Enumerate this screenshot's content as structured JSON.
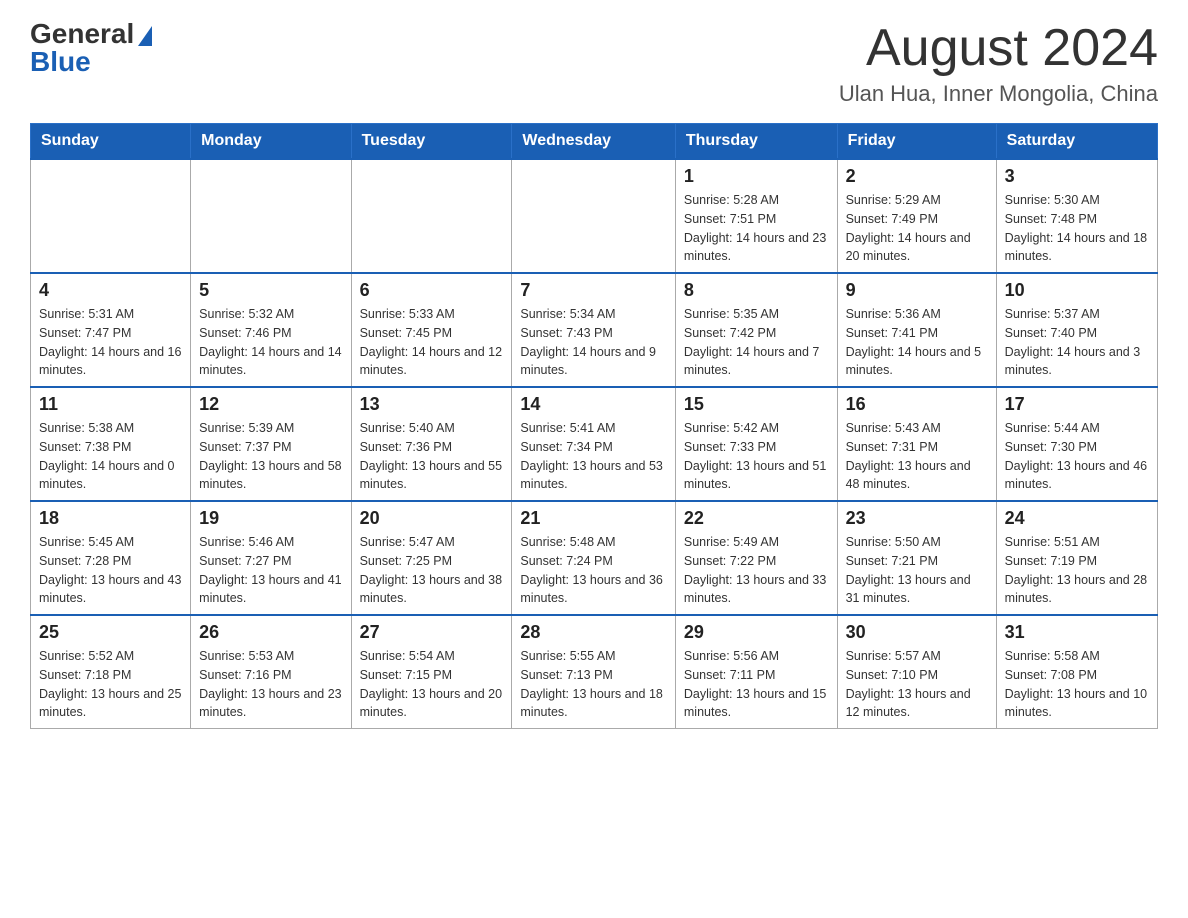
{
  "header": {
    "logo_general": "General",
    "logo_blue": "Blue",
    "month_title": "August 2024",
    "location": "Ulan Hua, Inner Mongolia, China"
  },
  "days_of_week": [
    "Sunday",
    "Monday",
    "Tuesday",
    "Wednesday",
    "Thursday",
    "Friday",
    "Saturday"
  ],
  "weeks": [
    [
      {
        "day": "",
        "sunrise": "",
        "sunset": "",
        "daylight": ""
      },
      {
        "day": "",
        "sunrise": "",
        "sunset": "",
        "daylight": ""
      },
      {
        "day": "",
        "sunrise": "",
        "sunset": "",
        "daylight": ""
      },
      {
        "day": "",
        "sunrise": "",
        "sunset": "",
        "daylight": ""
      },
      {
        "day": "1",
        "sunrise": "Sunrise: 5:28 AM",
        "sunset": "Sunset: 7:51 PM",
        "daylight": "Daylight: 14 hours and 23 minutes."
      },
      {
        "day": "2",
        "sunrise": "Sunrise: 5:29 AM",
        "sunset": "Sunset: 7:49 PM",
        "daylight": "Daylight: 14 hours and 20 minutes."
      },
      {
        "day": "3",
        "sunrise": "Sunrise: 5:30 AM",
        "sunset": "Sunset: 7:48 PM",
        "daylight": "Daylight: 14 hours and 18 minutes."
      }
    ],
    [
      {
        "day": "4",
        "sunrise": "Sunrise: 5:31 AM",
        "sunset": "Sunset: 7:47 PM",
        "daylight": "Daylight: 14 hours and 16 minutes."
      },
      {
        "day": "5",
        "sunrise": "Sunrise: 5:32 AM",
        "sunset": "Sunset: 7:46 PM",
        "daylight": "Daylight: 14 hours and 14 minutes."
      },
      {
        "day": "6",
        "sunrise": "Sunrise: 5:33 AM",
        "sunset": "Sunset: 7:45 PM",
        "daylight": "Daylight: 14 hours and 12 minutes."
      },
      {
        "day": "7",
        "sunrise": "Sunrise: 5:34 AM",
        "sunset": "Sunset: 7:43 PM",
        "daylight": "Daylight: 14 hours and 9 minutes."
      },
      {
        "day": "8",
        "sunrise": "Sunrise: 5:35 AM",
        "sunset": "Sunset: 7:42 PM",
        "daylight": "Daylight: 14 hours and 7 minutes."
      },
      {
        "day": "9",
        "sunrise": "Sunrise: 5:36 AM",
        "sunset": "Sunset: 7:41 PM",
        "daylight": "Daylight: 14 hours and 5 minutes."
      },
      {
        "day": "10",
        "sunrise": "Sunrise: 5:37 AM",
        "sunset": "Sunset: 7:40 PM",
        "daylight": "Daylight: 14 hours and 3 minutes."
      }
    ],
    [
      {
        "day": "11",
        "sunrise": "Sunrise: 5:38 AM",
        "sunset": "Sunset: 7:38 PM",
        "daylight": "Daylight: 14 hours and 0 minutes."
      },
      {
        "day": "12",
        "sunrise": "Sunrise: 5:39 AM",
        "sunset": "Sunset: 7:37 PM",
        "daylight": "Daylight: 13 hours and 58 minutes."
      },
      {
        "day": "13",
        "sunrise": "Sunrise: 5:40 AM",
        "sunset": "Sunset: 7:36 PM",
        "daylight": "Daylight: 13 hours and 55 minutes."
      },
      {
        "day": "14",
        "sunrise": "Sunrise: 5:41 AM",
        "sunset": "Sunset: 7:34 PM",
        "daylight": "Daylight: 13 hours and 53 minutes."
      },
      {
        "day": "15",
        "sunrise": "Sunrise: 5:42 AM",
        "sunset": "Sunset: 7:33 PM",
        "daylight": "Daylight: 13 hours and 51 minutes."
      },
      {
        "day": "16",
        "sunrise": "Sunrise: 5:43 AM",
        "sunset": "Sunset: 7:31 PM",
        "daylight": "Daylight: 13 hours and 48 minutes."
      },
      {
        "day": "17",
        "sunrise": "Sunrise: 5:44 AM",
        "sunset": "Sunset: 7:30 PM",
        "daylight": "Daylight: 13 hours and 46 minutes."
      }
    ],
    [
      {
        "day": "18",
        "sunrise": "Sunrise: 5:45 AM",
        "sunset": "Sunset: 7:28 PM",
        "daylight": "Daylight: 13 hours and 43 minutes."
      },
      {
        "day": "19",
        "sunrise": "Sunrise: 5:46 AM",
        "sunset": "Sunset: 7:27 PM",
        "daylight": "Daylight: 13 hours and 41 minutes."
      },
      {
        "day": "20",
        "sunrise": "Sunrise: 5:47 AM",
        "sunset": "Sunset: 7:25 PM",
        "daylight": "Daylight: 13 hours and 38 minutes."
      },
      {
        "day": "21",
        "sunrise": "Sunrise: 5:48 AM",
        "sunset": "Sunset: 7:24 PM",
        "daylight": "Daylight: 13 hours and 36 minutes."
      },
      {
        "day": "22",
        "sunrise": "Sunrise: 5:49 AM",
        "sunset": "Sunset: 7:22 PM",
        "daylight": "Daylight: 13 hours and 33 minutes."
      },
      {
        "day": "23",
        "sunrise": "Sunrise: 5:50 AM",
        "sunset": "Sunset: 7:21 PM",
        "daylight": "Daylight: 13 hours and 31 minutes."
      },
      {
        "day": "24",
        "sunrise": "Sunrise: 5:51 AM",
        "sunset": "Sunset: 7:19 PM",
        "daylight": "Daylight: 13 hours and 28 minutes."
      }
    ],
    [
      {
        "day": "25",
        "sunrise": "Sunrise: 5:52 AM",
        "sunset": "Sunset: 7:18 PM",
        "daylight": "Daylight: 13 hours and 25 minutes."
      },
      {
        "day": "26",
        "sunrise": "Sunrise: 5:53 AM",
        "sunset": "Sunset: 7:16 PM",
        "daylight": "Daylight: 13 hours and 23 minutes."
      },
      {
        "day": "27",
        "sunrise": "Sunrise: 5:54 AM",
        "sunset": "Sunset: 7:15 PM",
        "daylight": "Daylight: 13 hours and 20 minutes."
      },
      {
        "day": "28",
        "sunrise": "Sunrise: 5:55 AM",
        "sunset": "Sunset: 7:13 PM",
        "daylight": "Daylight: 13 hours and 18 minutes."
      },
      {
        "day": "29",
        "sunrise": "Sunrise: 5:56 AM",
        "sunset": "Sunset: 7:11 PM",
        "daylight": "Daylight: 13 hours and 15 minutes."
      },
      {
        "day": "30",
        "sunrise": "Sunrise: 5:57 AM",
        "sunset": "Sunset: 7:10 PM",
        "daylight": "Daylight: 13 hours and 12 minutes."
      },
      {
        "day": "31",
        "sunrise": "Sunrise: 5:58 AM",
        "sunset": "Sunset: 7:08 PM",
        "daylight": "Daylight: 13 hours and 10 minutes."
      }
    ]
  ]
}
